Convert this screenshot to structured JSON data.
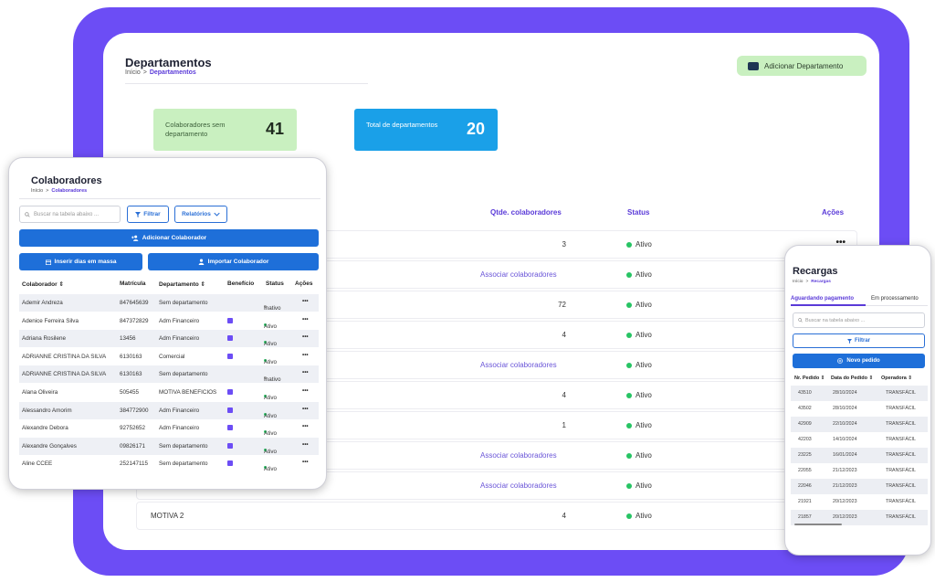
{
  "departments": {
    "title": "Departamentos",
    "breadcrumb": {
      "home": "Início",
      "separator": ">",
      "current": "Departamentos"
    },
    "add_button": "Adicionar Departamento",
    "stats": [
      {
        "label": "Colaboradores sem departamento",
        "value": "41"
      },
      {
        "label": "Total de departamentos",
        "value": "20"
      }
    ],
    "columns": {
      "qty": "Qtde. colaboradores",
      "status": "Status",
      "actions": "Ações"
    },
    "rows": [
      {
        "name": "",
        "qty": "3",
        "status": "Ativo",
        "actions": "•••"
      },
      {
        "name": "",
        "qty": "Associar colaboradores",
        "status": "Ativo",
        "actions": ""
      },
      {
        "name": "",
        "qty": "72",
        "status": "Ativo",
        "actions": ""
      },
      {
        "name": "",
        "qty": "4",
        "status": "Ativo",
        "actions": ""
      },
      {
        "name": "",
        "qty": "Associar colaboradores",
        "status": "Ativo",
        "actions": ""
      },
      {
        "name": "",
        "qty": "4",
        "status": "Ativo",
        "actions": ""
      },
      {
        "name": "",
        "qty": "1",
        "status": "Ativo",
        "actions": ""
      },
      {
        "name": "",
        "qty": "Associar colaboradores",
        "status": "Ativo",
        "actions": ""
      },
      {
        "name": "",
        "qty": "Associar colaboradores",
        "status": "Ativo",
        "actions": ""
      },
      {
        "name": "MOTIVA 2",
        "qty": "4",
        "status": "Ativo",
        "actions": ""
      }
    ]
  },
  "colaboradores": {
    "title": "Colaboradores",
    "breadcrumb": {
      "home": "Início",
      "separator": ">",
      "current": "Colaboradores"
    },
    "search_placeholder": "Buscar na tabela abaixo ...",
    "filter_label": "Filtrar",
    "reports_label": "Relatórios",
    "add_label": "Adicionar Colaborador",
    "insert_label": "Inserir dias em massa",
    "import_label": "Importar Colaborador",
    "columns": {
      "name": "Colaborador",
      "reg": "Matrícula",
      "dept": "Departamento",
      "benefit": "Benefício",
      "status": "Status",
      "actions": "Ações"
    },
    "rows": [
      {
        "name": "Ademir Andreza",
        "reg": "847645639",
        "dept": "Sem departamento",
        "benefit": false,
        "status": "Inativo",
        "actions": "•••"
      },
      {
        "name": "Adenice Ferreira Silva",
        "reg": "847372829",
        "dept": "Adm Financeiro",
        "benefit": true,
        "status": "Ativo",
        "actions": "•••"
      },
      {
        "name": "Adriana Rosilene",
        "reg": "13456",
        "dept": "Adm Financeiro",
        "benefit": true,
        "status": "Ativo",
        "actions": "•••"
      },
      {
        "name": "ADRIANNE CRISTINA DA SILVA",
        "reg": "6130163",
        "dept": "Comercial",
        "benefit": true,
        "status": "Ativo",
        "actions": "•••"
      },
      {
        "name": "ADRIANNE CRISTINA DA SILVA",
        "reg": "6130163",
        "dept": "Sem departamento",
        "benefit": false,
        "status": "Inativo",
        "actions": "•••"
      },
      {
        "name": "Alana Oliveira",
        "reg": "505455",
        "dept": "MOTIVA BENEFICIOS",
        "benefit": true,
        "status": "Ativo",
        "actions": "•••"
      },
      {
        "name": "Alessandro Amorim",
        "reg": "384772900",
        "dept": "Adm Financeiro",
        "benefit": true,
        "status": "Ativo",
        "actions": "•••"
      },
      {
        "name": "Alexandre Debora",
        "reg": "92752652",
        "dept": "Adm Financeiro",
        "benefit": true,
        "status": "Ativo",
        "actions": "•••"
      },
      {
        "name": "Alexandre Gonçalves",
        "reg": "09826171",
        "dept": "Sem departamento",
        "benefit": true,
        "status": "Ativo",
        "actions": "•••"
      },
      {
        "name": "Aline CCEE",
        "reg": "252147115",
        "dept": "Sem departamento",
        "benefit": true,
        "status": "Ativo",
        "actions": "•••"
      }
    ]
  },
  "recargas": {
    "title": "Recargas",
    "breadcrumb": {
      "home": "Início",
      "separator": ">",
      "current": "Recargas"
    },
    "tabs": [
      "Aguardando pagamento",
      "Em processamento"
    ],
    "search_placeholder": "Buscar na tabela abaixo ...",
    "filter_label": "Filtrar",
    "new_order_label": "Novo pedido",
    "columns": {
      "order": "Nr. Pedido",
      "date": "Data do Pedido",
      "operator": "Operadora"
    },
    "rows": [
      {
        "order": "43510",
        "date": "28/10/2024",
        "operator": "TRANSFÁCIL"
      },
      {
        "order": "43502",
        "date": "28/10/2024",
        "operator": "TRANSFÁCIL"
      },
      {
        "order": "42909",
        "date": "22/10/2024",
        "operator": "TRANSFÁCIL"
      },
      {
        "order": "42203",
        "date": "14/10/2024",
        "operator": "TRANSFÁCIL"
      },
      {
        "order": "23225",
        "date": "16/01/2024",
        "operator": "TRANSFÁCIL"
      },
      {
        "order": "22055",
        "date": "21/12/2023",
        "operator": "TRANSFÁCIL"
      },
      {
        "order": "22046",
        "date": "21/12/2023",
        "operator": "TRANSFÁCIL"
      },
      {
        "order": "21921",
        "date": "20/12/2023",
        "operator": "TRANSFÁCIL"
      },
      {
        "order": "21857",
        "date": "20/12/2023",
        "operator": "TRANSFÁCIL"
      }
    ]
  },
  "colors": {
    "purple": "#6c4df5",
    "green_card": "#c9f0c0",
    "blue_card": "#1aa0e8",
    "primary_button": "#1e6fd9",
    "status_active": "#27c464"
  }
}
